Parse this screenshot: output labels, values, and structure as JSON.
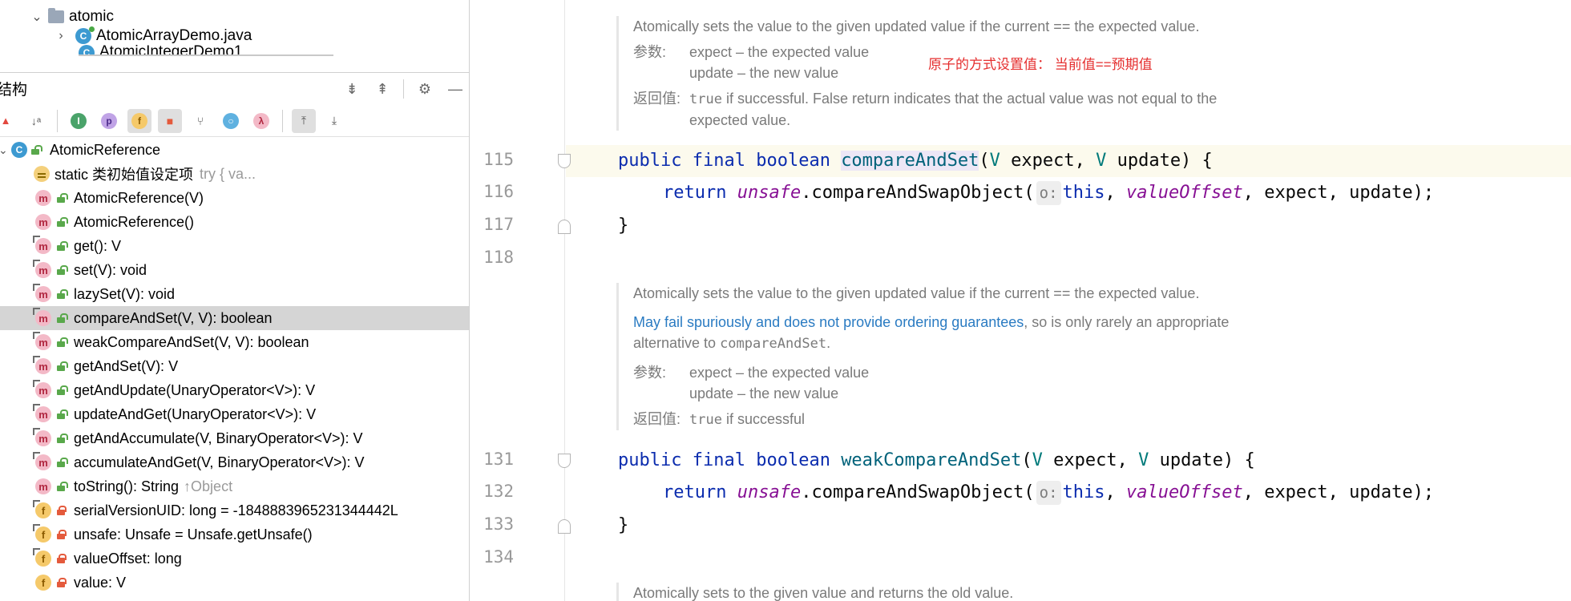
{
  "project_tree": {
    "folder": "atomic",
    "file": "AtomicArrayDemo.java",
    "partial_file": "AtomicIntegerDemo1"
  },
  "structure": {
    "title": "结构",
    "root": "AtomicReference",
    "items": [
      {
        "kind": "init",
        "label": "static 类初始值设定项",
        "extra": "try {            va...",
        "access": "unlocked"
      },
      {
        "kind": "method",
        "label": "AtomicReference(V)",
        "access": "unlocked",
        "overrides": false
      },
      {
        "kind": "method",
        "label": "AtomicReference()",
        "access": "unlocked",
        "overrides": false
      },
      {
        "kind": "method",
        "label": "get(): V",
        "access": "unlocked",
        "overrides": true
      },
      {
        "kind": "method",
        "label": "set(V): void",
        "access": "unlocked",
        "overrides": true
      },
      {
        "kind": "method",
        "label": "lazySet(V): void",
        "access": "unlocked",
        "overrides": true
      },
      {
        "kind": "method",
        "label": "compareAndSet(V, V): boolean",
        "access": "unlocked",
        "overrides": true,
        "selected": true
      },
      {
        "kind": "method",
        "label": "weakCompareAndSet(V, V): boolean",
        "access": "unlocked",
        "overrides": true
      },
      {
        "kind": "method",
        "label": "getAndSet(V): V",
        "access": "unlocked",
        "overrides": true
      },
      {
        "kind": "method",
        "label": "getAndUpdate(UnaryOperator<V>): V",
        "access": "unlocked",
        "overrides": true
      },
      {
        "kind": "method",
        "label": "updateAndGet(UnaryOperator<V>): V",
        "access": "unlocked",
        "overrides": true
      },
      {
        "kind": "method",
        "label": "getAndAccumulate(V, BinaryOperator<V>): V",
        "access": "unlocked",
        "overrides": true
      },
      {
        "kind": "method",
        "label": "accumulateAndGet(V, BinaryOperator<V>): V",
        "access": "unlocked",
        "overrides": true
      },
      {
        "kind": "method",
        "label": "toString(): String",
        "extra": "↑Object",
        "access": "unlocked",
        "overrides": false
      },
      {
        "kind": "field",
        "label": "serialVersionUID: long = -1848883965231344442L",
        "access": "locked",
        "overrides": true
      },
      {
        "kind": "field",
        "label": "unsafe: Unsafe = Unsafe.getUnsafe()",
        "access": "locked",
        "overrides": true
      },
      {
        "kind": "field",
        "label": "valueOffset: long",
        "access": "locked",
        "overrides": true
      },
      {
        "kind": "field",
        "label": "value: V",
        "access": "locked",
        "overrides": false
      }
    ]
  },
  "toolbar_icons": [
    "sort-visibility-icon",
    "sort-alpha-icon",
    "show-inherited-icon",
    "show-properties-icon",
    "show-fields-icon",
    "show-non-public-icon",
    "show-anonymous-icon",
    "show-lambdas-icon",
    "circle-icon",
    "expand-icon",
    "autoscroll-from-source-icon",
    "autoscroll-to-source-icon"
  ],
  "editor": {
    "doc1": {
      "summary": "Atomically sets the value to the given updated value if the current == the expected value.",
      "params_label": "参数:",
      "param1": "expect – the expected value",
      "param2": "update – the new value",
      "returns_label": "返回值:",
      "returns_code": "true",
      "returns_text": " if successful. False return indicates that the actual value was not equal to the",
      "returns_text2": "expected value."
    },
    "note": "原子的方式设置值：  当前值==预期值",
    "code1": {
      "l115": "115",
      "l116": "116",
      "l117": "117",
      "l118": "118",
      "kw_public": "public",
      "kw_final": "final",
      "kw_boolean": "boolean",
      "method": "compareAndSet",
      "paren_open": "(",
      "type_v": "V",
      "p_expect": " expect, ",
      "p_update": " update) {",
      "kw_return": "return",
      "unsafe": "unsafe",
      "call": ".compareAndSwapObject(",
      "hint": "o:",
      "kw_this": "this",
      "comma": ", ",
      "valueOffset": "valueOffset",
      "tail": ", expect, update);",
      "close": "}"
    },
    "doc2": {
      "summary": "Atomically sets the value to the given updated value if the current == the expected value.",
      "link": "May fail spuriously and does not provide ordering guarantees",
      "after_link": ", so is only rarely an appropriate",
      "line3a": "alternative to ",
      "line3code": "compareAndSet",
      "line3b": ".",
      "params_label": "参数:",
      "param1": "expect – the expected value",
      "param2": "update – the new value",
      "returns_label": "返回值:",
      "returns_code": "true",
      "returns_text": " if successful"
    },
    "code2": {
      "l131": "131",
      "l132": "132",
      "l133": "133",
      "l134": "134",
      "method": "weakCompareAndSet"
    },
    "doc3": {
      "summary": "Atomically sets to the given value and returns the old value."
    }
  }
}
